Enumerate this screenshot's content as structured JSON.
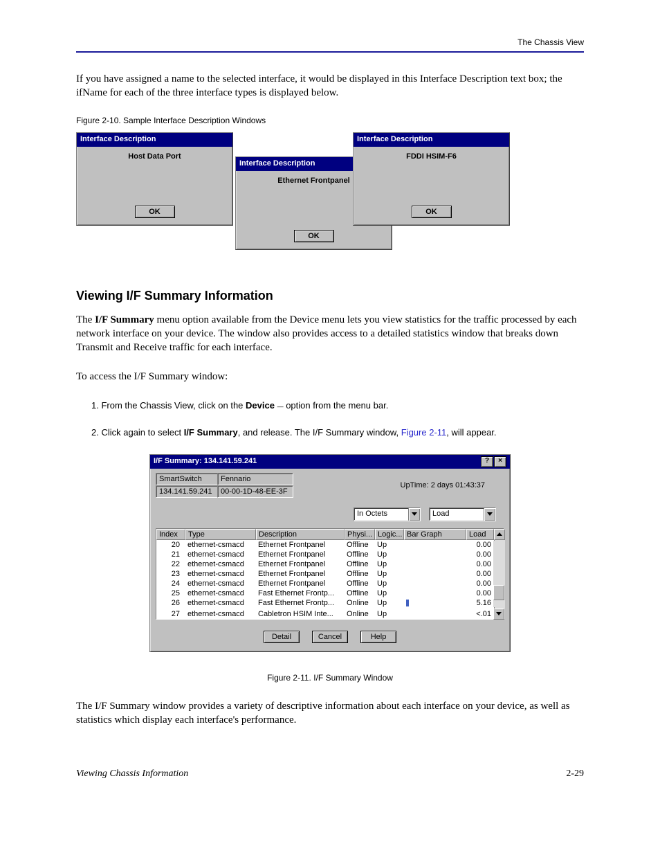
{
  "running_head": "The Chassis View",
  "para1": "If you have assigned a name to the selected interface, it would be displayed in this Interface Description text box; the ifName for each of the three interface types is displayed below.",
  "fig_caption_a": {
    "label": "Figure 2-10.",
    "text": "Sample Interface Description Windows"
  },
  "dialogs": {
    "title": "Interface Description",
    "ok": "OK",
    "c1": "Host Data Port",
    "c2": "Ethernet Frontpanel",
    "c3": "FDDI HSIM-F6"
  },
  "section_heading": "Viewing I/F Summary Information",
  "para2_a": "The ",
  "para2_b": "I/F Summary",
  "para2_c": " menu option available from the Device menu lets you view statistics for the traffic processed by each network interface on your device. The window also provides access to a detailed statistics window that breaks down Transmit and Receive traffic for each interface.",
  "para3_a": "To access the I/F Summary window:",
  "step1_a": "1. From the Chassis View, click on the ",
  "step1_b": "Device",
  "step1_c": " option from the menu bar.",
  "step2_a": "2. Click again to select ",
  "step2_b": "I/F Summary",
  "step2_c": ", and release. The I/F Summary window, ",
  "step2_d": "Figure 2-11",
  "step2_e": ", will appear.",
  "summary": {
    "titlebar": "I/F Summary: 134.141.59.241",
    "name": "SmartSwitch",
    "location": "Fennario",
    "ip": "134.141.59.241",
    "mac": "00-00-1D-48-EE-3F",
    "uptime": "UpTime: 2 days 01:43:37",
    "combo1": "In Octets",
    "combo2": "Load",
    "cols": {
      "c1": "Index",
      "c2": "Type",
      "c3": "Description",
      "c4": "Physi...",
      "c5": "Logic...",
      "c6": "Bar Graph",
      "c7": "Load"
    },
    "rows": [
      {
        "i": "20",
        "t": "ethernet-csmacd",
        "d": "Ethernet Frontpanel",
        "p": "Offline",
        "l": "Up",
        "bar": "",
        "ld": "0.00"
      },
      {
        "i": "21",
        "t": "ethernet-csmacd",
        "d": "Ethernet Frontpanel",
        "p": "Offline",
        "l": "Up",
        "bar": "",
        "ld": "0.00"
      },
      {
        "i": "22",
        "t": "ethernet-csmacd",
        "d": "Ethernet Frontpanel",
        "p": "Offline",
        "l": "Up",
        "bar": "",
        "ld": "0.00"
      },
      {
        "i": "23",
        "t": "ethernet-csmacd",
        "d": "Ethernet Frontpanel",
        "p": "Offline",
        "l": "Up",
        "bar": "",
        "ld": "0.00"
      },
      {
        "i": "24",
        "t": "ethernet-csmacd",
        "d": "Ethernet Frontpanel",
        "p": "Offline",
        "l": "Up",
        "bar": "",
        "ld": "0.00"
      },
      {
        "i": "25",
        "t": "ethernet-csmacd",
        "d": "Fast Ethernet Frontp...",
        "p": "Offline",
        "l": "Up",
        "bar": "",
        "ld": "0.00"
      },
      {
        "i": "26",
        "t": "ethernet-csmacd",
        "d": "Fast Ethernet Frontp...",
        "p": "Online",
        "l": "Up",
        "bar": "1",
        "ld": "5.16"
      },
      {
        "i": "27",
        "t": "ethernet-csmacd",
        "d": "Cabletron HSIM Inte...",
        "p": "Online",
        "l": "Up",
        "bar": "",
        "ld": "<.01"
      }
    ],
    "btns": {
      "detail": "Detail",
      "cancel": "Cancel",
      "help": "Help"
    }
  },
  "fig_caption_b": {
    "label": "Figure 2-11.",
    "text": "I/F Summary Window"
  },
  "para4": "The I/F Summary window provides a variety of descriptive information about each interface on your device, as well as statistics which display each interface's performance.",
  "footer_left": "Viewing Chassis Information",
  "footer_right": "2-29"
}
